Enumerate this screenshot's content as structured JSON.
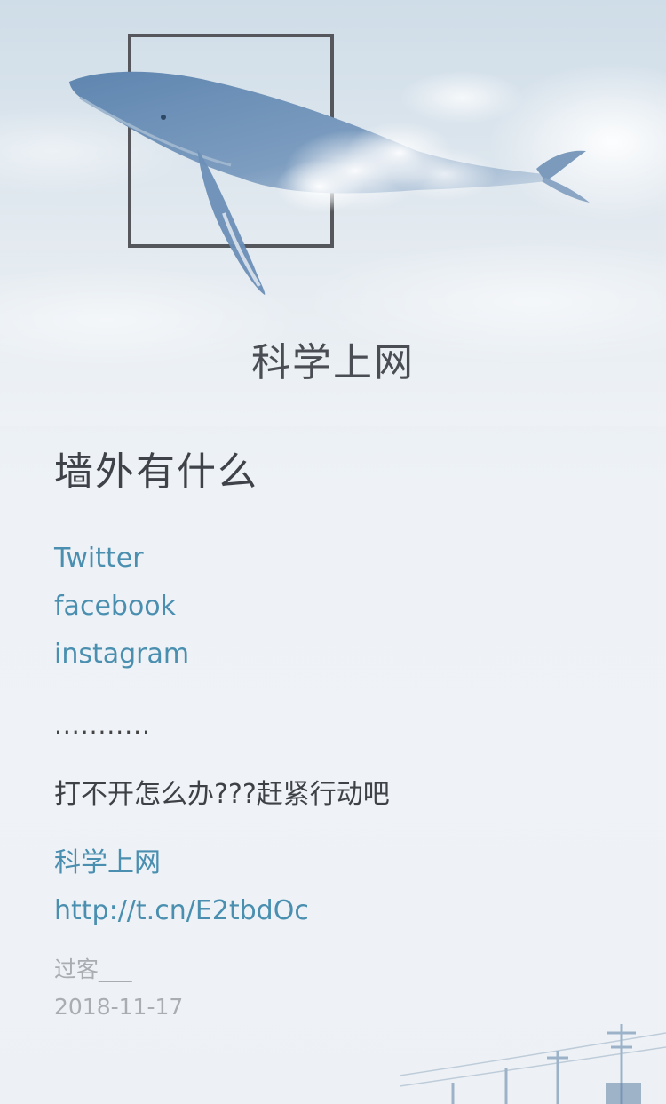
{
  "hero": {
    "title": "科学上网",
    "illustration": "whale-icon"
  },
  "article": {
    "heading": "墙外有什么",
    "sites": [
      "Twitter",
      "facebook",
      "instagram"
    ],
    "ellipsis": "...........",
    "prompt": "打不开怎么办???赶紧行动吧",
    "cta_label": "科学上网",
    "cta_url": "http://t.cn/E2tbdOc",
    "author": "过客___",
    "date": "2018-11-17"
  },
  "colors": {
    "link": "#4a8fb0",
    "text": "#3f4349",
    "muted": "#a9adb2"
  }
}
